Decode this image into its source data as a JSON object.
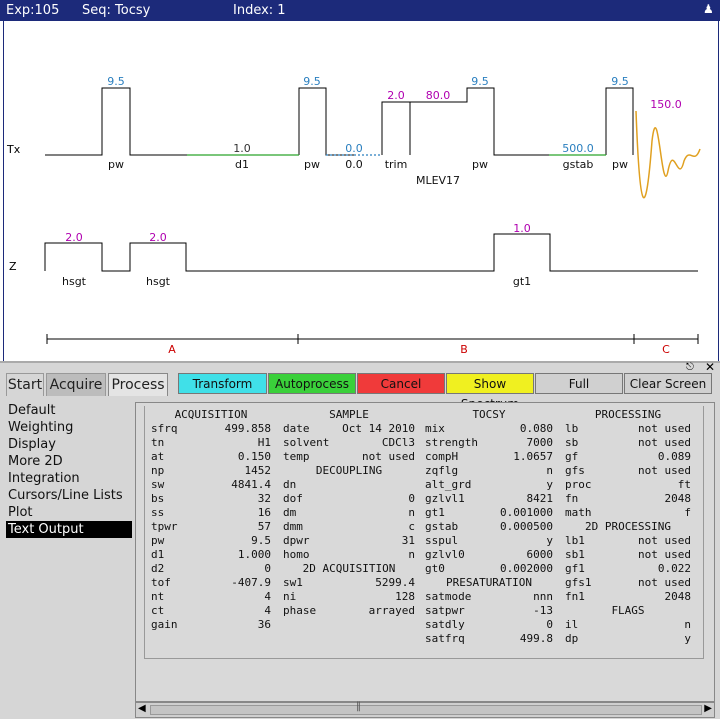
{
  "title_bar": {
    "exp": "Exp:105",
    "seq": "Seq: Tocsy",
    "index": "Index: 1"
  },
  "pulse_sequence": {
    "tx_label": "Tx",
    "z_label": "Z",
    "tx_values": [
      "9.5",
      "1.0",
      "9.5",
      "0.0",
      "2.0",
      "80.0",
      "9.5",
      "500.0",
      "9.5",
      "150.0"
    ],
    "tx_names": [
      "pw",
      "d1",
      "pw",
      "0.0",
      "trim",
      "pw",
      "gstab",
      "pw"
    ],
    "mlev_label": "MLEV17",
    "z_values": [
      "2.0",
      "2.0",
      "1.0"
    ],
    "z_names": [
      "hsgt",
      "hsgt",
      "gt1"
    ],
    "sections": [
      "A",
      "B",
      "C"
    ],
    "colors": {
      "blue_value": "#2a7fbf",
      "magenta_value": "#b000b0",
      "gray_value": "#333333",
      "green_delay": "#2aa52a",
      "acquire": "#e0a020",
      "section_label": "#cc0000"
    }
  },
  "tabs": [
    {
      "label": "Start"
    },
    {
      "label": "Acquire"
    },
    {
      "label": "Process"
    }
  ],
  "buttons": {
    "transform": "Transform",
    "autoprocess": "Autoprocess",
    "cancel": "Cancel",
    "show_spectrum": "Show Spectrum",
    "full": "Full",
    "clear_screen": "Clear Screen",
    "colors": {
      "transform": "#40e0e8",
      "autoprocess": "#3ad03a",
      "cancel": "#f03a3a",
      "show_spectrum": "#f0f020",
      "full": "#d0d0d0"
    }
  },
  "sidebar": [
    "Default",
    "Weighting",
    "Display",
    "More 2D",
    "Integration",
    "Cursors/Line Lists",
    "Plot",
    "Text Output"
  ],
  "sidebar_selected": "Text Output",
  "text_output": {
    "col1": [
      {
        "h": "ACQUISITION"
      },
      {
        "k": "sfrq",
        "v": "499.858"
      },
      {
        "k": "tn",
        "v": "H1"
      },
      {
        "k": "at",
        "v": "0.150"
      },
      {
        "k": "np",
        "v": "1452"
      },
      {
        "k": "sw",
        "v": "4841.4"
      },
      {
        "k": "bs",
        "v": "32"
      },
      {
        "k": "ss",
        "v": "16"
      },
      {
        "k": "tpwr",
        "v": "57"
      },
      {
        "k": "pw",
        "v": "9.5"
      },
      {
        "k": "d1",
        "v": "1.000"
      },
      {
        "k": "d2",
        "v": "0"
      },
      {
        "k": "tof",
        "v": "-407.9"
      },
      {
        "k": "nt",
        "v": "4"
      },
      {
        "k": "ct",
        "v": "4"
      },
      {
        "k": "gain",
        "v": "36"
      }
    ],
    "col2": [
      {
        "h": "SAMPLE"
      },
      {
        "k": "date",
        "v": "Oct 14 2010"
      },
      {
        "k": "solvent",
        "v": "CDCl3"
      },
      {
        "k": "temp",
        "v": "not used"
      },
      {
        "h": "DECOUPLING"
      },
      {
        "k": "dn",
        "v": ""
      },
      {
        "k": "dof",
        "v": "0"
      },
      {
        "k": "dm",
        "v": "n"
      },
      {
        "k": "dmm",
        "v": "c"
      },
      {
        "k": "dpwr",
        "v": "31"
      },
      {
        "k": "homo",
        "v": "n"
      },
      {
        "h": "2D ACQUISITION"
      },
      {
        "k": "sw1",
        "v": "5299.4"
      },
      {
        "k": "ni",
        "v": "128"
      },
      {
        "k": "phase",
        "v": "arrayed"
      }
    ],
    "col3": [
      {
        "h": "TOCSY"
      },
      {
        "k": "mix",
        "v": "0.080"
      },
      {
        "k": "strength",
        "v": "7000"
      },
      {
        "k": "compH",
        "v": "1.0657"
      },
      {
        "k": "zqflg",
        "v": "n"
      },
      {
        "k": "alt_grd",
        "v": "y"
      },
      {
        "k": "gzlvl1",
        "v": "8421"
      },
      {
        "k": "gt1",
        "v": "0.001000"
      },
      {
        "k": "gstab",
        "v": "0.000500"
      },
      {
        "k": "sspul",
        "v": "y"
      },
      {
        "k": "gzlvl0",
        "v": "6000"
      },
      {
        "k": "gt0",
        "v": "0.002000"
      },
      {
        "h": "PRESATURATION"
      },
      {
        "k": "satmode",
        "v": "nnn"
      },
      {
        "k": "satpwr",
        "v": "-13"
      },
      {
        "k": "satdly",
        "v": "0"
      },
      {
        "k": "satfrq",
        "v": "499.8"
      }
    ],
    "col4": [
      {
        "h": "PROCESSING"
      },
      {
        "k": "lb",
        "v": "not used"
      },
      {
        "k": "sb",
        "v": "not used"
      },
      {
        "k": "gf",
        "v": "0.089"
      },
      {
        "k": "gfs",
        "v": "not used"
      },
      {
        "k": "proc",
        "v": "ft"
      },
      {
        "k": "fn",
        "v": "2048"
      },
      {
        "k": "math",
        "v": "f"
      },
      {
        "h": "2D PROCESSING"
      },
      {
        "k": "lb1",
        "v": "not used"
      },
      {
        "k": "sb1",
        "v": "not used"
      },
      {
        "k": "gf1",
        "v": "0.022"
      },
      {
        "k": "gfs1",
        "v": "not used"
      },
      {
        "k": "fn1",
        "v": "2048"
      },
      {
        "h": "FLAGS"
      },
      {
        "k": "il",
        "v": "n"
      },
      {
        "k": "dp",
        "v": "y"
      }
    ]
  }
}
